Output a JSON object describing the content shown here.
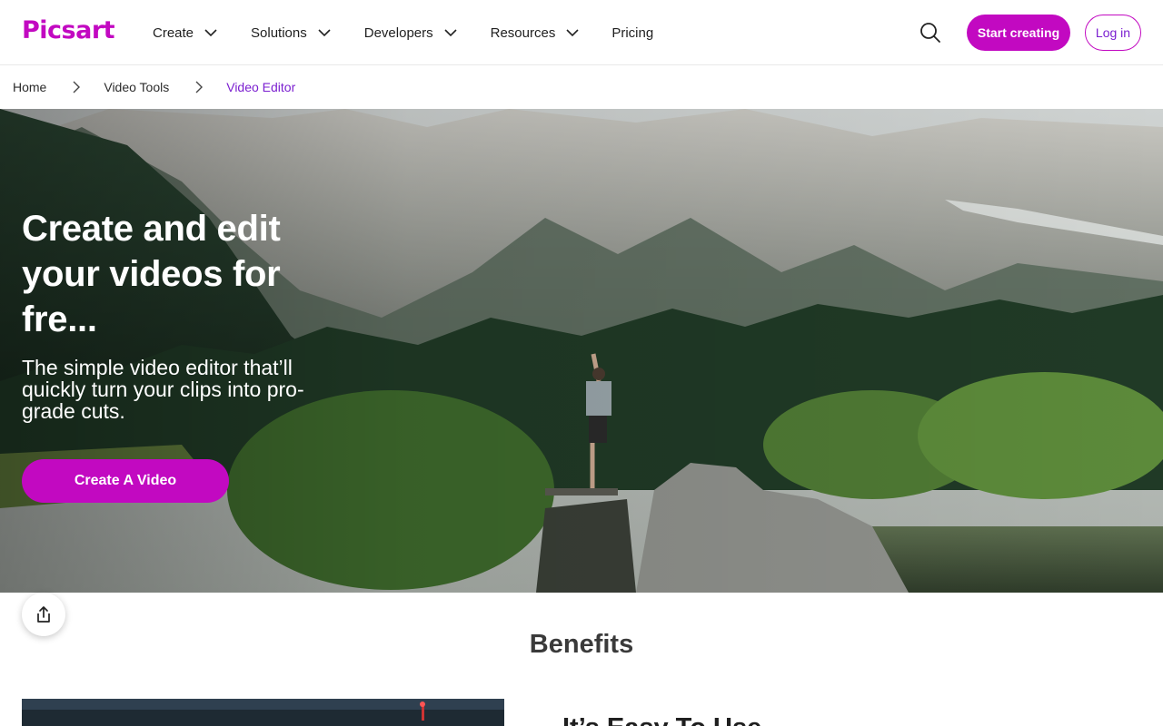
{
  "brand": {
    "name": "Picsart",
    "accent": "#c209c1",
    "text_link": "#7b1fd0"
  },
  "header": {
    "nav": [
      {
        "label": "Create",
        "has_dropdown": true
      },
      {
        "label": "Solutions",
        "has_dropdown": true
      },
      {
        "label": "Developers",
        "has_dropdown": true
      },
      {
        "label": "Resources",
        "has_dropdown": true
      },
      {
        "label": "Pricing",
        "has_dropdown": false
      }
    ],
    "search_icon": "search-icon",
    "start_label": "Start creating",
    "login_label": "Log in"
  },
  "breadcrumb": {
    "items": [
      "Home",
      "Video Tools",
      "Video Editor"
    ],
    "separator_icon": "chevron-right-icon"
  },
  "hero": {
    "title": "Create and edit your videos for fre...",
    "subtitle": "The simple video editor that’ll quickly turn your clips into pro-grade cuts.",
    "cta_label": "Create A Video"
  },
  "share_icon": "share-icon",
  "benefits": {
    "title": "Benefits",
    "first_heading": "It’s Easy To Use"
  }
}
